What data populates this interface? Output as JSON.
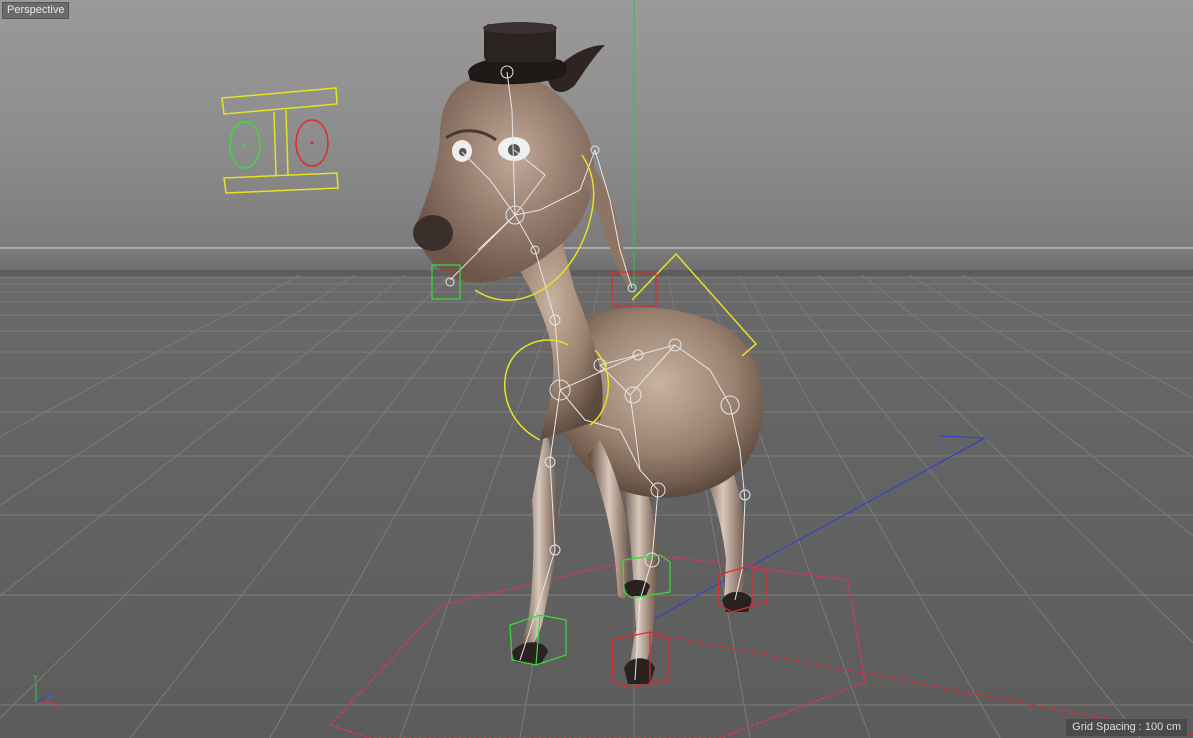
{
  "viewport": {
    "label": "Perspective",
    "grid_spacing_text": "Grid Spacing : 100 cm"
  },
  "axis_gizmo": {
    "y": "Y",
    "z": "Z",
    "x": "X"
  },
  "colors": {
    "background_top": "#9a9a9a",
    "floor": "#646464",
    "grid_line": "#7a7a7a",
    "y_axis": "#2ec44a",
    "z_axis": "#2a3fd8",
    "x_axis": "#d83a3a",
    "rig_yellow": "#e3e327",
    "rig_green": "#3adc3a",
    "rig_red": "#e02a2a",
    "rig_pink": "#e8305a",
    "joint_white": "#e6e6e6",
    "goat_body": "#a18a77"
  }
}
